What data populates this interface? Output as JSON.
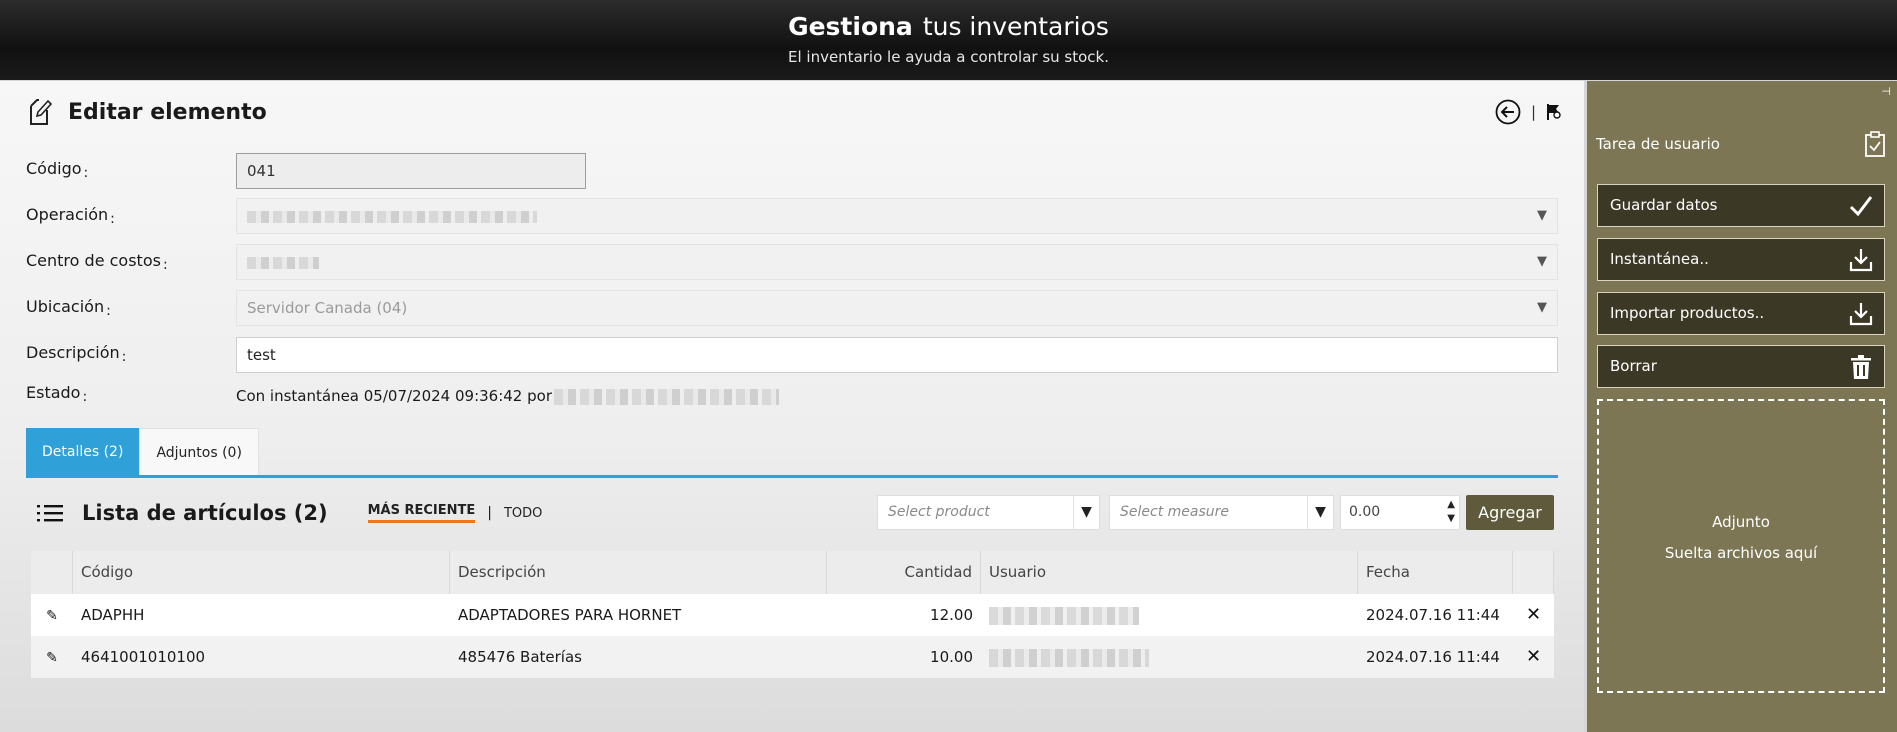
{
  "header": {
    "title_bold": "Gestiona",
    "title_rest": "tus inventarios",
    "subtitle": "El inventario le ayuda a controlar su stock."
  },
  "page": {
    "title": "Editar elemento",
    "separator": "|"
  },
  "form": {
    "code_label": "Código",
    "code_value": "041",
    "operation_label": "Operación",
    "cost_center_label": "Centro de costos",
    "location_label": "Ubicación",
    "location_value": "Servidor Canada (04)",
    "description_label": "Descripción",
    "description_value": "test",
    "status_label": "Estado",
    "status_value": "Con instantánea 05/07/2024 09:36:42 por",
    "colon": ":",
    "select_arrow": "▼"
  },
  "tabs": [
    {
      "label": "Detalles (2)",
      "active": true
    },
    {
      "label": "Adjuntos (0)",
      "active": false
    }
  ],
  "list": {
    "title": "Lista de artículos (2)",
    "filter_recent": "MÁS RECIENTE",
    "filter_sep": "|",
    "filter_all": "TODO",
    "product_placeholder": "Select product",
    "measure_placeholder": "Select measure",
    "quantity_value": "0.00",
    "add_label": "Agregar"
  },
  "table": {
    "columns": [
      "Código",
      "Descripción",
      "Cantidad",
      "Usuario",
      "Fecha"
    ],
    "rows": [
      {
        "code": "ADAPHH",
        "description": "ADAPTADORES PARA HORNET",
        "quantity": "12.00",
        "date": "2024.07.16 11:44"
      },
      {
        "code": "4641001010100",
        "description": "485476 Baterías",
        "quantity": "10.00",
        "date": "2024.07.16 11:44"
      }
    ]
  },
  "sidebar": {
    "task_label": "Tarea de usuario",
    "buttons": [
      {
        "label": "Guardar datos",
        "icon": "check-icon"
      },
      {
        "label": "Instantánea..",
        "icon": "download-icon"
      },
      {
        "label": "Importar productos..",
        "icon": "download-icon"
      },
      {
        "label": "Borrar",
        "icon": "trash-icon"
      }
    ],
    "drop_title": "Adjunto",
    "drop_hint": "Suelta archivos aquí"
  },
  "colors": {
    "accent_blue": "#2fa0d8",
    "accent_orange": "#e9771f",
    "sidebar_olive": "#7d7655",
    "button_dark": "#3c3826",
    "add_button": "#5e5a3b"
  }
}
